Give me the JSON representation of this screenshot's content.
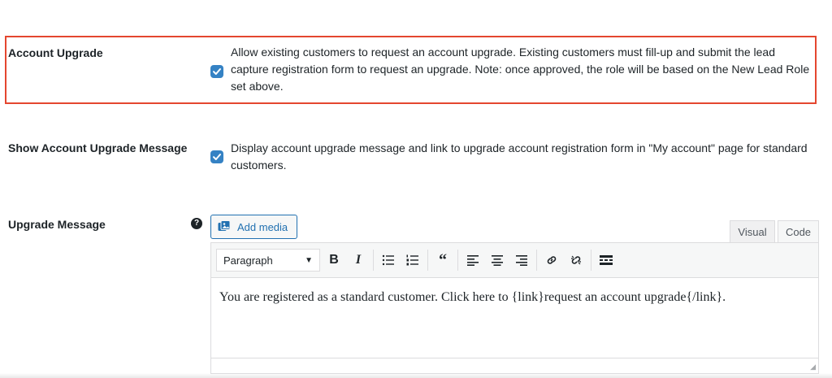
{
  "account_upgrade": {
    "label": "Account Upgrade",
    "checked": true,
    "description": "Allow existing customers to request an account upgrade. Existing customers must fill-up and submit the lead capture registration form to request an upgrade. Note: once approved, the role will be based on the New Lead Role set above."
  },
  "show_upgrade_message": {
    "label": "Show Account Upgrade Message",
    "checked": true,
    "description": "Display account upgrade message and link to upgrade account registration form in \"My account\" page for standard customers."
  },
  "upgrade_message": {
    "label": "Upgrade Message",
    "help_icon": "?",
    "add_media_label": "Add media",
    "tabs": [
      "Visual",
      "Code"
    ],
    "format_select": "Paragraph",
    "toolbar_icons": [
      "bold-icon",
      "italic-icon",
      "bullet-list-icon",
      "numbered-list-icon",
      "blockquote-icon",
      "align-left-icon",
      "align-center-icon",
      "align-right-icon",
      "link-icon",
      "unlink-icon",
      "toolbar-toggle-icon"
    ],
    "content": "You are registered as a standard customer. Click here to {link}request an account upgrade{/link}."
  },
  "colors": {
    "accent": "#2271b1",
    "checkbox": "#3582c4",
    "highlight": "#e4462f"
  }
}
